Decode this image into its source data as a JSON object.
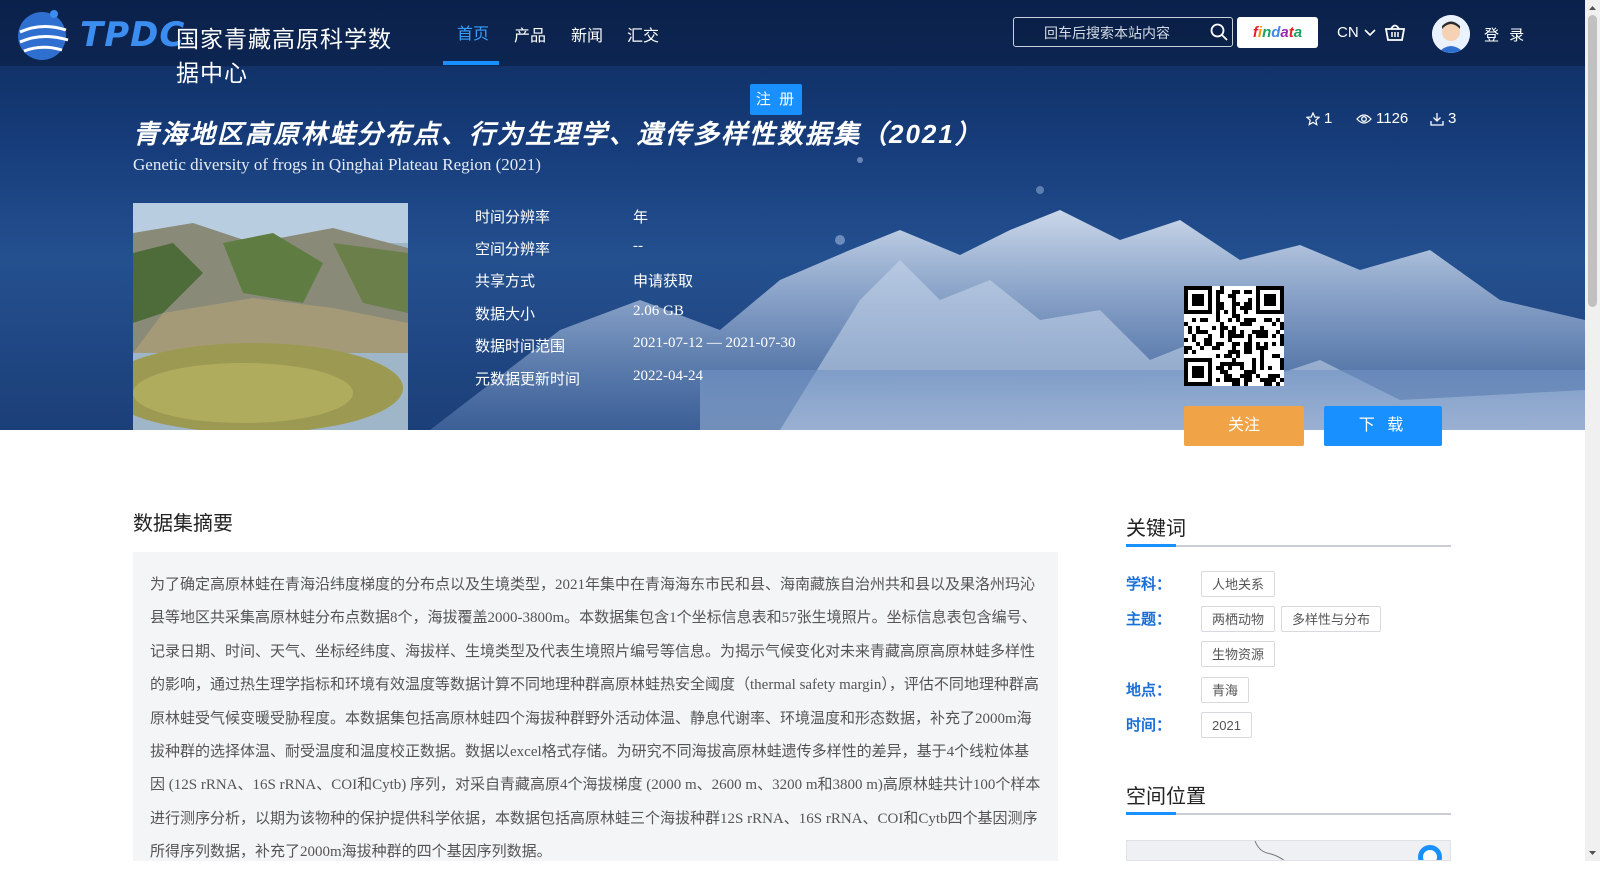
{
  "nav": {
    "logo_mark": "TPDC",
    "logo_text": "国家青藏高原科学数据中心",
    "menu": [
      "首页",
      "产品",
      "新闻",
      "汇交"
    ],
    "active_index": 0,
    "search_placeholder": "回车后搜索本站内容",
    "findata_letters": [
      "f",
      "i",
      "n",
      "d",
      "a",
      "t",
      "a"
    ],
    "findata_colors": [
      "#e6202a",
      "#f39800",
      "#1aa260",
      "#4285f4",
      "#9c27b0",
      "#e6202a",
      "#1aa260"
    ],
    "lang": "CN",
    "login": "登 录",
    "register": "注 册"
  },
  "dataset": {
    "title_cn": "青海地区高原林蛙分布点、行为生理学、遗传多样性数据集（2021）",
    "title_en": "Genetic diversity of frogs in Qinghai Plateau Region (2021)",
    "stats": {
      "favorites": "1",
      "views": "1126",
      "downloads": "3"
    },
    "info": [
      {
        "label": "时间分辨率",
        "value": "年"
      },
      {
        "label": "空间分辨率",
        "value": "--"
      },
      {
        "label": "共享方式",
        "value": "申请获取"
      },
      {
        "label": "数据大小",
        "value": "2.06 GB"
      },
      {
        "label": "数据时间范围",
        "value": "2021-07-12 — 2021-07-30"
      },
      {
        "label": "元数据更新时间",
        "value": "2022-04-24"
      }
    ],
    "follow_label": "关注",
    "download_label": "下 载"
  },
  "abstract": {
    "heading": "数据集摘要",
    "text": "为了确定高原林蛙在青海沿纬度梯度的分布点以及生境类型，2021年集中在青海海东市民和县、海南藏族自治州共和县以及果洛州玛沁县等地区共采集高原林蛙分布点数据8个，海拔覆盖2000-3800m。本数据集包含1个坐标信息表和57张生境照片。坐标信息表包含编号、记录日期、时间、天气、坐标经纬度、海拔样、生境类型及代表生境照片编号等信息。为揭示气候变化对未来青藏高原高原林蛙多样性的影响，通过热生理学指标和环境有效温度等数据计算不同地理种群高原林蛙热安全阈度（thermal safety margin），评估不同地理种群高原林蛙受气候变暖受胁程度。本数据集包括高原林蛙四个海拔种群野外活动体温、静息代谢率、环境温度和形态数据，补充了2000m海拔种群的选择体温、耐受温度和温度校正数据。数据以excel格式存储。为研究不同海拔高原林蛙遗传多样性的差异，基于4个线粒体基因 (12S rRNA、16S rRNA、COI和Cytb) 序列，对采自青藏高原4个海拔梯度 (2000 m、2600 m、3200 m和3800 m)高原林蛙共计100个样本进行测序分析，以期为该物种的保护提供科学依据，本数据包括高原林蛙三个海拔种群12S rRNA、16S rRNA、COI和Cytb四个基因测序所得序列数据，补充了2000m海拔种群的四个基因序列数据。"
  },
  "keywords": {
    "heading": "关键词",
    "groups": [
      {
        "label": "学科：",
        "tags": [
          "人地关系"
        ]
      },
      {
        "label": "主题：",
        "tags": [
          "两栖动物",
          "多样性与分布",
          "生物资源"
        ]
      },
      {
        "label": "地点：",
        "tags": [
          "青海"
        ]
      },
      {
        "label": "时间：",
        "tags": [
          "2021"
        ]
      }
    ]
  },
  "location": {
    "heading": "空间位置"
  },
  "colors": {
    "accent": "#1890ff",
    "follow": "#f0a447",
    "keyword_label": "#1a6fd8"
  },
  "icons": [
    "globe-logo-icon",
    "search-icon",
    "chevron-down-icon",
    "cart-icon",
    "avatar-icon",
    "star-icon",
    "eye-icon",
    "download-icon",
    "qr-code-icon"
  ]
}
